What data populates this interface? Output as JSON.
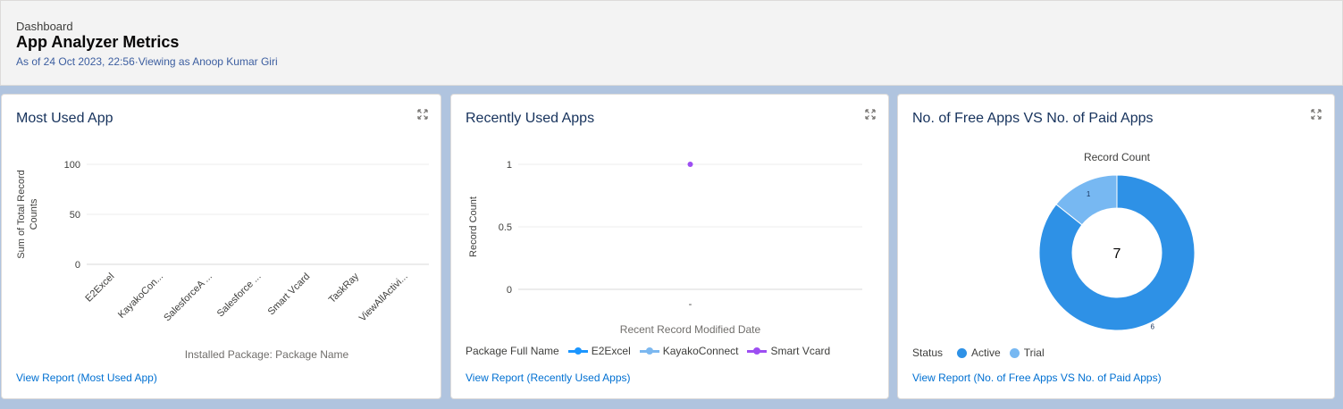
{
  "header": {
    "breadcrumb": "Dashboard",
    "title": "App Analyzer Metrics",
    "subtitle": "As of 24 Oct 2023, 22:56·Viewing as Anoop Kumar Giri"
  },
  "cards": {
    "most_used": {
      "title": "Most Used App",
      "link": "View Report (Most Used App)",
      "expand_icon": "expand-icon"
    },
    "recent": {
      "title": "Recently Used Apps",
      "link": "View Report (Recently Used Apps)",
      "legend_title": "Package Full Name"
    },
    "free_paid": {
      "title": "No. of Free Apps VS No. of Paid Apps",
      "link": "View Report (No. of Free Apps VS No. of Paid Apps)",
      "legend_title": "Status"
    }
  },
  "chart_data": [
    {
      "type": "bar",
      "title": "Most Used App",
      "xlabel": "Installed Package: Package Name",
      "ylabel_lines": [
        "Sum of Total Record",
        "Counts"
      ],
      "categories": [
        "E2Excel",
        "KayakoCon...",
        "SalesforceA ...",
        "Salesforce ...",
        "Smart Vcard",
        "TaskRay",
        "ViewAllActivi..."
      ],
      "values": [
        0,
        0,
        0,
        0,
        0,
        0,
        0
      ],
      "yticks": [
        0,
        50,
        100
      ],
      "ylim": [
        0,
        100
      ]
    },
    {
      "type": "line",
      "title": "Recently Used Apps",
      "xlabel": "Recent Record Modified Date",
      "ylabel": "Record Count",
      "yticks": [
        "0",
        "0.5",
        "1"
      ],
      "ylim": [
        0,
        1
      ],
      "x_categories": [
        "-"
      ],
      "series": [
        {
          "name": "E2Excel",
          "color": "#1b96ff",
          "values": [
            null
          ]
        },
        {
          "name": "KayakoConnect",
          "color": "#7cb8f0",
          "values": [
            null
          ]
        },
        {
          "name": "Smart Vcard",
          "color": "#9d4ef2",
          "values": [
            1
          ]
        }
      ]
    },
    {
      "type": "pie",
      "title": "Record Count",
      "center_label": "7",
      "slices": [
        {
          "name": "Active",
          "value": 6,
          "color": "#2e91e6"
        },
        {
          "name": "Trial",
          "value": 1,
          "color": "#77b8f2"
        }
      ]
    }
  ]
}
